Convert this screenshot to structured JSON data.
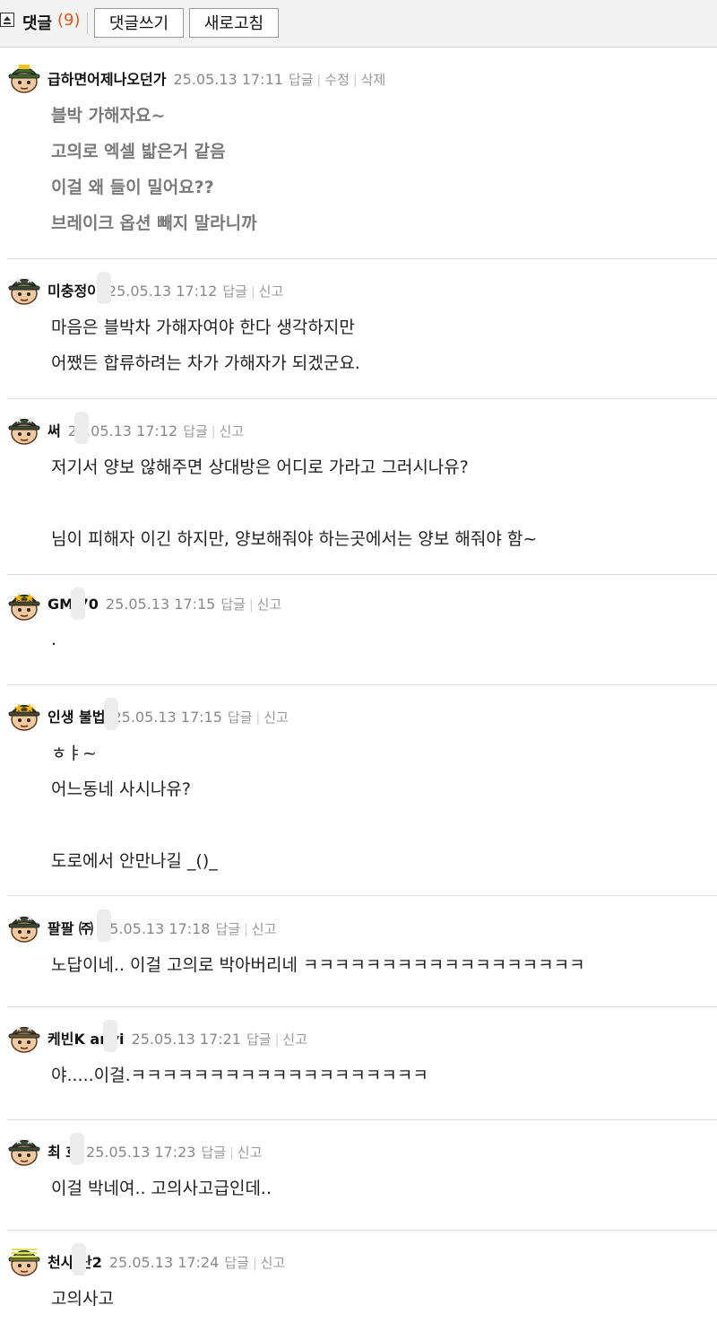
{
  "header": {
    "title": "댓글",
    "count": "(9)",
    "write_button": "댓글쓰기",
    "refresh_button": "새로고침"
  },
  "comments": [
    {
      "nickname": "급하면어제나오던가",
      "date": "25.05.13 17:11",
      "actions": [
        "답글",
        "수정",
        "삭제"
      ],
      "lines": [
        "블박 가해자요~",
        "고의로 엑셀 밟은거 같음",
        "이걸 왜 들이 밀어요??",
        "브레이크 옵션 빼지 말라니까"
      ],
      "avatar_icon": "general-avatar-icon"
    },
    {
      "nickname": "미충정이",
      "date": "25.05.13 17:12",
      "actions": [
        "답글",
        "신고"
      ],
      "lines": [
        "마음은 블박차 가해자여야 한다 생각하지만",
        "어쨌든 합류하려는 차가 가해자가 되겠군요."
      ],
      "avatar_icon": "soldier-avatar-icon"
    },
    {
      "nickname": "써",
      "date": "25.05.13 17:12",
      "actions": [
        "답글",
        "신고"
      ],
      "lines": [
        "저기서 양보 않해주면 상대방은 어디로 가라고 그러시나유?",
        "",
        "님이 피해자 이긴 하지만, 양보해줘야 하는곳에서는 양보 해줘야 함~"
      ],
      "avatar_icon": "soldier-avatar-icon"
    },
    {
      "nickname": "GM 70",
      "date": "25.05.13 17:15",
      "actions": [
        "답글",
        "신고"
      ],
      "lines": [
        "."
      ],
      "avatar_icon": "star-officer-avatar-icon"
    },
    {
      "nickname": "인생 불법",
      "date": "25.05.13 17:15",
      "actions": [
        "답글",
        "신고"
      ],
      "lines": [
        "ㅎㅑ~",
        "어느동네 사시나유?",
        "",
        "도로에서 안만나길 _()_"
      ],
      "avatar_icon": "star-officer-avatar-icon"
    },
    {
      "nickname": "팔팔 ㈜",
      "date": "25.05.13 17:18",
      "actions": [
        "답글",
        "신고"
      ],
      "lines": [
        "노답이네.. 이걸 고의로 박아버리네 ㅋㅋㅋㅋㅋㅋㅋㅋㅋㅋㅋㅋㅋㅋㅋㅋㅋㅋ"
      ],
      "avatar_icon": "soldier-avatar-icon"
    },
    {
      "nickname": "케빈K anyi",
      "date": "25.05.13 17:21",
      "actions": [
        "답글",
        "신고"
      ],
      "lines": [
        "야.....이걸.ㅋㅋㅋㅋㅋㅋㅋㅋㅋㅋㅋㅋㅋㅋㅋㅋㅋㅋㅋ"
      ],
      "avatar_icon": "trainee-avatar-icon"
    },
    {
      "nickname": "최 호",
      "date": "25.05.13 17:23",
      "actions": [
        "답글",
        "신고"
      ],
      "lines": [
        "이걸 박네여.. 고의사고급인데.."
      ],
      "avatar_icon": "soldier-avatar-icon"
    },
    {
      "nickname": "천사 단2",
      "date": "25.05.13 17:24",
      "actions": [
        "답글",
        "신고"
      ],
      "lines": [
        "고의사고"
      ],
      "avatar_icon": "reservist-avatar-icon"
    }
  ],
  "colors": {
    "count": "#e8551c",
    "meta": "#888888",
    "divider": "#dcdcdc",
    "first_comment_text": "#7a7a7a"
  }
}
